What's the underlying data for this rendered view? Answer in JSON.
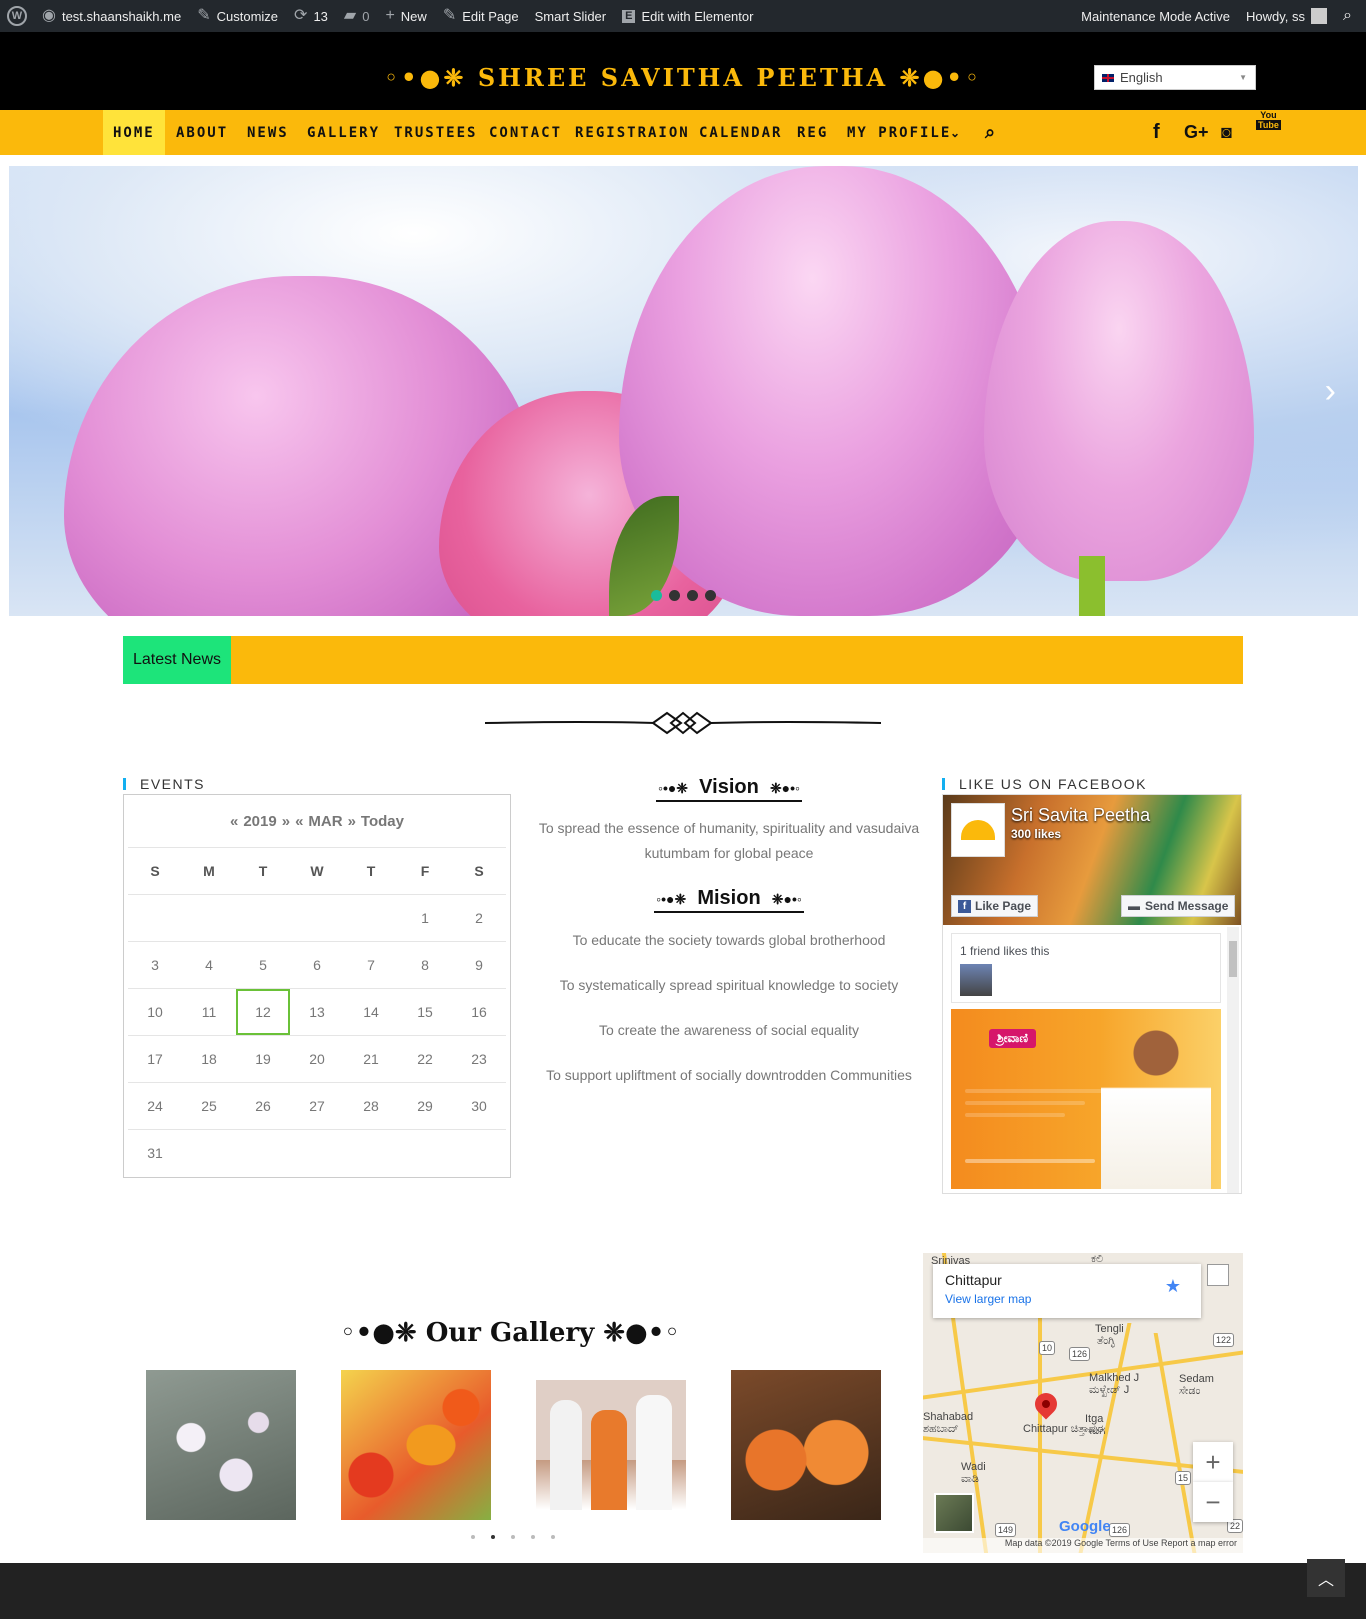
{
  "adminbar": {
    "site": "test.shaanshaikh.me",
    "customize": "Customize",
    "updates": "13",
    "comments": "0",
    "new": "New",
    "edit_page": "Edit Page",
    "smart_slider": "Smart Slider",
    "elementor": "Edit with Elementor",
    "maintenance": "Maintenance Mode Active",
    "howdy": "Howdy, ss"
  },
  "header": {
    "title": "◦•●❈ SHREE SAVITHA PEETHA ❈●•◦",
    "language": "English"
  },
  "nav": {
    "items": [
      "HOME",
      "ABOUT",
      "NEWS",
      "GALLERY",
      "TRUSTEES",
      "CONTACT",
      "REGISTRAION",
      "CALENDAR",
      "REG",
      "MY PROFILE"
    ]
  },
  "news": {
    "label": "Latest News"
  },
  "events": {
    "title": "EVENTS",
    "prev_year": "«",
    "year": "2019",
    "next_year": "»",
    "prev_month": "«",
    "month": "MAR",
    "next_month": "»",
    "today": "Today",
    "weekdays": [
      "S",
      "M",
      "T",
      "W",
      "T",
      "F",
      "S"
    ],
    "weeks": [
      [
        "",
        "",
        "",
        "",
        "",
        "1",
        "2"
      ],
      [
        "3",
        "4",
        "5",
        "6",
        "7",
        "8",
        "9"
      ],
      [
        "10",
        "11",
        "12",
        "13",
        "14",
        "15",
        "16"
      ],
      [
        "17",
        "18",
        "19",
        "20",
        "21",
        "22",
        "23"
      ],
      [
        "24",
        "25",
        "26",
        "27",
        "28",
        "29",
        "30"
      ],
      [
        "31",
        "",
        "",
        "",
        "",
        "",
        ""
      ]
    ]
  },
  "vision": {
    "title": "Vision",
    "ornament_left": "◦•●❈",
    "ornament_right": "❈●•◦",
    "text": "To spread the essence of humanity, spirituality and vasudaiva kutumbam for global peace"
  },
  "mission": {
    "title": "Mision",
    "ornament_left": "◦•●❈",
    "ornament_right": "❈●•◦",
    "items": [
      "To educate the society towards global brotherhood",
      "To systematically spread spiritual knowledge to society",
      "To create the awareness of social equality",
      "To support upliftment of socially downtrodden Communities"
    ]
  },
  "facebook": {
    "title": "LIKE US ON FACEBOOK",
    "page_name": "Sri Savita Peetha",
    "likes": "300 likes",
    "like_page": "Like Page",
    "send_message": "Send Message",
    "friends": "1 friend likes this",
    "post_tag": "ಶ್ರೀವಾಣಿ"
  },
  "gallery": {
    "title": "◦•●❈ Our Gallery ❈●•◦"
  },
  "map": {
    "place": "Chittapur",
    "link": "View larger map",
    "labels": {
      "srinivas": "Srinivas",
      "tengli": "Tengli",
      "tengli_kn": "ತೆಂಗ್ಳಿ",
      "malkhed": "Malkhed J",
      "malkhed_kn": "ಮಳ್ಖೇಡ್ J",
      "sedam": "Sedam",
      "sedam_kn": "ಸೇಡಂ",
      "shahabad": "Shahabad",
      "shahabad_kn": "ಶಹಬಾದ್",
      "chittapur_kn": "Chittapur ಚಿತ್ತಾಪುರ",
      "itga": "Itga",
      "itga_kn": "ಇಟಗ",
      "wadi": "Wadi",
      "wadi_kn": "ವಾಡಿ",
      "kali": "ಕಲಿ",
      "r10": "10",
      "r122": "122",
      "r126": "126",
      "r15": "15",
      "r149": "149",
      "r126b": "126",
      "r122b": "22"
    },
    "google": "Google",
    "footer": "Map data ©2019 Google   Terms of Use   Report a map error"
  },
  "colors": {
    "brand_yellow": "#fbb90b",
    "news_green": "#1de47a",
    "calendar_today": "#6ac138"
  }
}
